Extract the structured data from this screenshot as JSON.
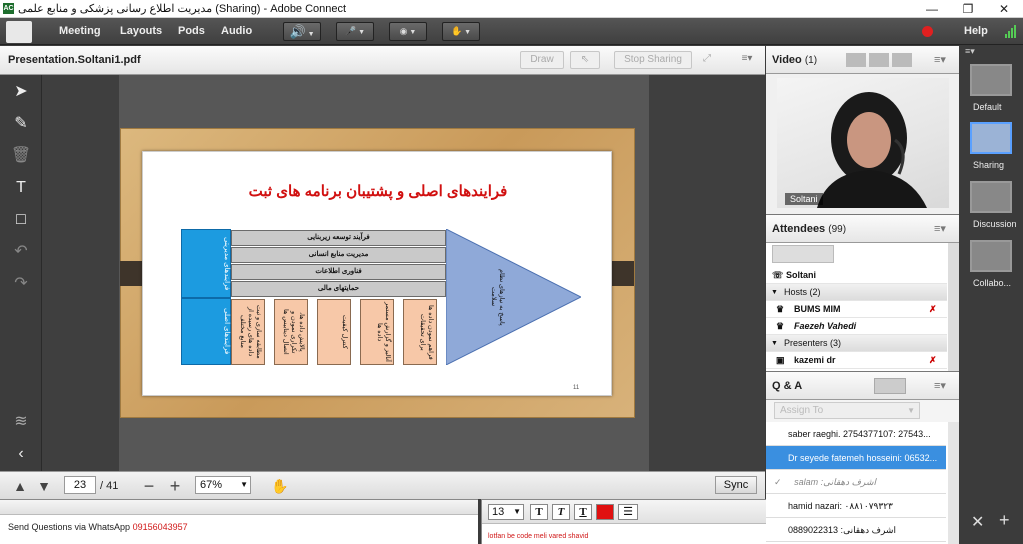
{
  "window": {
    "app_icon": "AC",
    "title": "مدیریت اطلاع رسانی پزشکی و منابع علمی (Sharing) - Adobe Connect"
  },
  "menubar": {
    "items": [
      "Meeting",
      "Layouts",
      "Pods",
      "Audio"
    ],
    "help": "Help",
    "record_color": "#e02020"
  },
  "presentation": {
    "title": "Presentation.Soltani1.pdf",
    "draw_label": "Draw",
    "stop_sharing_label": "Stop Sharing",
    "slide": {
      "title": "فرایندهای اصلی و پشتیبان برنامه های ثبت",
      "left_top_box": "فرایندهای مدیریتی",
      "left_bottom_box": "فرایندهای اصلی",
      "bars": [
        "فرآیند توسعه زیربنایی",
        "مدیریت منابع انسانی",
        "فناوری اطلاعات",
        "حمایتهای مالی"
      ],
      "columns": [
        "فراهم نمودن داده ها برای تحقیقات",
        "آنالیز و گزارش مستمر داده ها",
        "کنترل کیفیت",
        "پالایش داده ها، تکراری نمودن و اتصال دیتابیس ها",
        "مطابقه سازی و ثبت داده های رسیده از منابع مختلف"
      ],
      "arrow_text": "پاسخ به نیازهای نظام سلامت",
      "page_number": "11"
    },
    "nav": {
      "current_page": "23",
      "total": "/ 41",
      "zoom": "67%",
      "sync_label": "Sync"
    }
  },
  "chat": {
    "message_prefix": "Send Questions via WhatsApp",
    "phone": "09156043957"
  },
  "notes": {
    "font_size": "13",
    "text_color": "#e01010",
    "text": "lotfan be code meli vared shavid"
  },
  "video": {
    "title": "Video",
    "count": "(1)",
    "presenter_name": "Soltani"
  },
  "attendees": {
    "title": "Attendees",
    "count": "(99)",
    "current_user": "Soltani",
    "hosts_label": "Hosts (2)",
    "hosts": [
      "BUMS MIM",
      "Faezeh Vahedi"
    ],
    "presenters_label": "Presenters (3)",
    "presenters": [
      "kazemi dr"
    ]
  },
  "qa": {
    "title": "Q & A",
    "assign_placeholder": "Assign To",
    "questions": [
      {
        "text": "saber raeghi. 2754377107: 27543...",
        "selected": false
      },
      {
        "text": "Dr seyede fatemeh hosseini: 06532...",
        "selected": true
      },
      {
        "text": "اشرف دهقانی: salam",
        "selected": false,
        "answered": true
      },
      {
        "text": "hamid nazari: ۰۸۸۱۰۷۹۳۲۳",
        "selected": false
      },
      {
        "text": "0889022313 :اشرف دهقانی",
        "selected": false
      }
    ]
  },
  "layouts": {
    "items": [
      "Default",
      "Sharing",
      "Discussion",
      "Collabo..."
    ]
  }
}
